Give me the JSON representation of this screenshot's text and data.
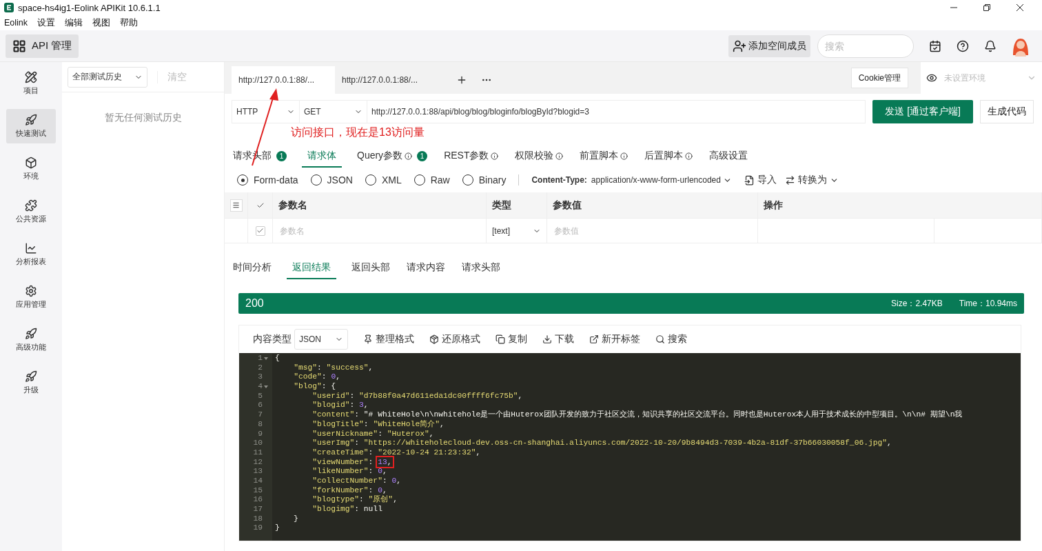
{
  "window": {
    "title": "space-hs4ig1-Eolink APIKit 10.6.1.1"
  },
  "menu": [
    "Eolink",
    "设置",
    "编辑",
    "视图",
    "帮助"
  ],
  "toolbar": {
    "app_button": "API 管理",
    "add_member": "添加空间成员",
    "search": {
      "placeholder": "搜索"
    }
  },
  "nav": [
    {
      "label": "项目",
      "selected": false
    },
    {
      "label": "快速测试",
      "selected": true
    },
    {
      "label": "环境",
      "selected": false
    },
    {
      "label": "公共资源",
      "selected": false
    },
    {
      "label": "分析报表",
      "selected": false
    },
    {
      "label": "应用管理",
      "selected": false
    },
    {
      "label": "高级功能",
      "selected": false
    },
    {
      "label": "升级",
      "selected": false
    }
  ],
  "history": {
    "filter": "全部测试历史",
    "clear": "清空",
    "empty": "暂无任何测试历史"
  },
  "request_tabs": [
    {
      "label": "http://127.0.0.1:88/...",
      "selected": true
    },
    {
      "label": "http://127.0.0.1:88/...",
      "selected": false
    }
  ],
  "cookie_button": "Cookie管理",
  "environment": {
    "placeholder": "未设置环境"
  },
  "request": {
    "protocol": "HTTP",
    "method": "GET",
    "url": "http://127.0.0.1:88/api/blog/blog/bloginfo/blogById?blogid=3",
    "send": "发送 [通过客户端]",
    "generate": "生成代码"
  },
  "annotation": {
    "text": "访问接口，现在是13访问量"
  },
  "param_tabs": [
    {
      "label": "请求头部",
      "badge": "1",
      "info": false,
      "selected": false
    },
    {
      "label": "请求体",
      "info": false,
      "selected": true
    },
    {
      "label": "Query参数",
      "badge": "1",
      "info": true,
      "selected": false
    },
    {
      "label": "REST参数",
      "info": true,
      "selected": false
    },
    {
      "label": "权限校验",
      "info": true,
      "selected": false
    },
    {
      "label": "前置脚本",
      "info": true,
      "selected": false
    },
    {
      "label": "后置脚本",
      "info": true,
      "selected": false
    },
    {
      "label": "高级设置",
      "info": false,
      "selected": false
    }
  ],
  "body_types": [
    {
      "label": "Form-data",
      "selected": true
    },
    {
      "label": "JSON",
      "selected": false
    },
    {
      "label": "XML",
      "selected": false
    },
    {
      "label": "Raw",
      "selected": false
    },
    {
      "label": "Binary",
      "selected": false
    }
  ],
  "content_type": {
    "label": "Content-Type:",
    "value": "application/x-www-form-urlencoded"
  },
  "import": "导入",
  "convert": "转换为",
  "params_table": {
    "columns": [
      "参数名",
      "类型",
      "参数值",
      "操作"
    ],
    "all_checked": true,
    "rows": [
      {
        "checked": true,
        "name_placeholder": "参数名",
        "type": "[text]",
        "value_placeholder": "参数值"
      }
    ]
  },
  "result_tabs": [
    {
      "label": "时间分析",
      "selected": false
    },
    {
      "label": "返回结果",
      "selected": true
    },
    {
      "label": "返回头部",
      "selected": false
    },
    {
      "label": "请求内容",
      "selected": false
    },
    {
      "label": "请求头部",
      "selected": false
    }
  ],
  "status": {
    "code": "200",
    "size": "Size：2.47KB",
    "time": "Time：10.94ms"
  },
  "response_toolbar": {
    "label": "内容类型",
    "format": "JSON",
    "actions": [
      "整理格式",
      "还原格式",
      "复制",
      "下载",
      "新开标签",
      "搜索"
    ]
  },
  "code_lines": [
    {
      "number": "1",
      "text": "{",
      "foldable": true,
      "boxed": false
    },
    {
      "number": "2",
      "text": "    \"msg\": \"success\",",
      "foldable": false,
      "boxed": false
    },
    {
      "number": "3",
      "text": "    \"code\": 0,",
      "foldable": false,
      "boxed": false
    },
    {
      "number": "4",
      "text": "    \"blog\": {",
      "foldable": true,
      "boxed": false
    },
    {
      "number": "5",
      "text": "        \"userid\": \"d7b88f0a47d611eda1dc00ffff6fc75b\",",
      "foldable": false,
      "boxed": false
    },
    {
      "number": "6",
      "text": "        \"blogid\": 3,",
      "foldable": false,
      "boxed": false
    },
    {
      "number": "7",
      "text": "        \"content\": \"# WhiteHole\\n\\nwhitehole是一个由Huterox团队开发的致力于社区交流，知识共享的社区交流平台。同时也是Huterox本人用于技术成长的中型项目。\\n\\n# 期望\\n我",
      "foldable": false,
      "boxed": false
    },
    {
      "number": "8",
      "text": "        \"blogTitle\": \"WhiteHole简介\",",
      "foldable": false,
      "boxed": false
    },
    {
      "number": "9",
      "text": "        \"userNickname\": \"Huterox\",",
      "foldable": false,
      "boxed": false
    },
    {
      "number": "10",
      "text": "        \"userImg\": \"https://whiteholecloud-dev.oss-cn-shanghai.aliyuncs.com/2022-10-20/9b8494d3-7039-4b2a-81df-37b66030058f_06.jpg\",",
      "foldable": false,
      "boxed": false
    },
    {
      "number": "11",
      "text": "        \"createTime\": \"2022-10-24 21:23:32\",",
      "foldable": false,
      "boxed": false
    },
    {
      "number": "12",
      "text": "        \"viewNumber\": 13,",
      "foldable": false,
      "boxed": true
    },
    {
      "number": "13",
      "text": "        \"likeNumber\": 0,",
      "foldable": false,
      "boxed": false
    },
    {
      "number": "14",
      "text": "        \"collectNumber\": 0,",
      "foldable": false,
      "boxed": false
    },
    {
      "number": "15",
      "text": "        \"forkNumber\": 0,",
      "foldable": false,
      "boxed": false
    },
    {
      "number": "16",
      "text": "        \"blogtype\": \"原创\",",
      "foldable": false,
      "boxed": false
    },
    {
      "number": "17",
      "text": "        \"blogimg\": null",
      "foldable": false,
      "boxed": false
    },
    {
      "number": "18",
      "text": "    }",
      "foldable": false,
      "boxed": false
    },
    {
      "number": "19",
      "text": "}",
      "foldable": false,
      "boxed": false
    }
  ]
}
